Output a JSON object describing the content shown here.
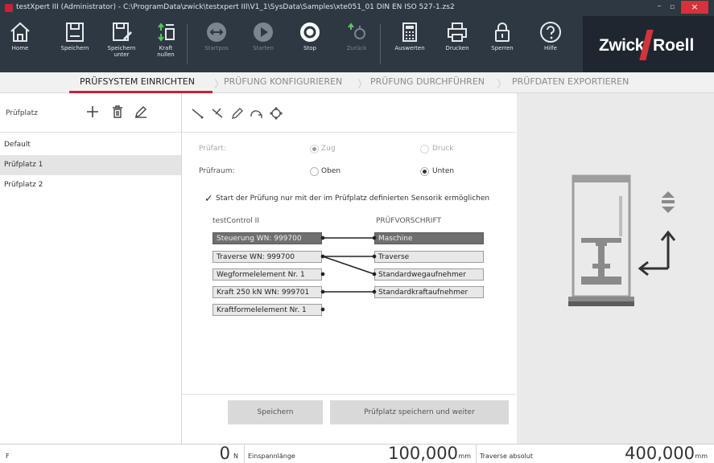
{
  "window": {
    "title": "testXpert III (Administrator) - C:\\ProgramData\\zwick\\testxpert III\\V1_1\\SysData\\Samples\\xte051_01 DIN EN ISO 527-1.zs2",
    "close_glyph": "×",
    "min_glyph": "–",
    "max_glyph": "▫"
  },
  "ribbon": {
    "home": "Home",
    "save": "Speichern",
    "save_as": "Speichern\nunter",
    "zero_force": "Kraft\nnullen",
    "startpos": "Startpos",
    "start": "Starten",
    "stop": "Stop",
    "back": "Zurück",
    "evaluate": "Auswerten",
    "print": "Drucken",
    "lock": "Sperren",
    "help": "Hilfe"
  },
  "logo": {
    "part1": "Zwick",
    "part2": "Roell"
  },
  "tabs": [
    "PRÜFSYSTEM EINRICHTEN",
    "PRÜFUNG KONFIGURIEREN",
    "PRÜFUNG DURCHFÜHREN",
    "PRÜFDATEN EXPORTIEREN"
  ],
  "sidebar": {
    "header": "Prüfplatz",
    "items": [
      "Default",
      "Prüfplatz 1",
      "Prüfplatz 2"
    ],
    "selected": "Prüfplatz 1"
  },
  "form": {
    "pruefart_label": "Prüfart:",
    "pruefart_opt1": "Zug",
    "pruefart_opt2": "Druck",
    "pruefraum_label": "Prüfraum:",
    "pruefraum_opt1": "Oben",
    "pruefraum_opt2": "Unten",
    "checkbox_label": "Start der Prüfung nur mit der im Prüfplatz definierten Sensorik ermöglichen",
    "check_glyph": "✓"
  },
  "mapping": {
    "left_header": "testControl II",
    "right_header": "PRÜFVORSCHRIFT",
    "left": [
      "Steuerung WN: 999700",
      "Traverse WN: 999700",
      "Wegformelelement Nr. 1",
      "Kraft 250 kN WN: 999701",
      "Kraftformelelement Nr. 1"
    ],
    "right": [
      "Maschine",
      "Traverse",
      "Standardwegaufnehmer",
      "Standardkraftaufnehmer"
    ]
  },
  "buttons": {
    "save": "Speichern",
    "save_next": "Prüfplatz speichern und weiter"
  },
  "status": {
    "f_label": "F",
    "f_value": "0",
    "f_unit": "N",
    "clamp_label": "Einspannlänge",
    "clamp_value": "100,000",
    "clamp_unit": "mm",
    "traverse_label": "Traverse absolut",
    "traverse_value": "400,000",
    "traverse_unit": "mm"
  },
  "colors": {
    "accent": "#c6223a",
    "ribbon": "#2d3842"
  }
}
